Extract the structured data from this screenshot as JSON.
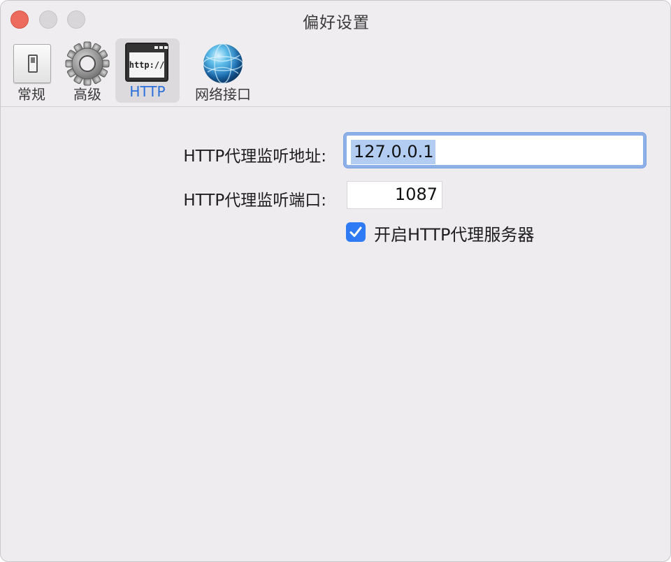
{
  "window": {
    "title": "偏好设置",
    "buttons": [
      "close",
      "minimize",
      "zoom"
    ]
  },
  "toolbar": {
    "items": [
      {
        "label": "常规",
        "icon": "toggle-switch-icon",
        "active": false
      },
      {
        "label": "高级",
        "icon": "gear-icon",
        "active": false
      },
      {
        "label": "HTTP",
        "icon": "http-window-icon",
        "icon_text": "http://",
        "active": true
      },
      {
        "label": "网络接口",
        "icon": "globe-icon",
        "active": false
      }
    ]
  },
  "form": {
    "address_label": "HTTP代理监听地址:",
    "address_value": "127.0.0.1",
    "port_label": "HTTP代理监听端口:",
    "port_value": "1087",
    "enable_label": "开启HTTP代理服务器",
    "enable_checked": true
  },
  "colors": {
    "accent": "#2f7bf5",
    "active_tab_text": "#2a6fdb",
    "close_button": "#ec6a5e",
    "focus_ring": "#8eb0e8"
  }
}
